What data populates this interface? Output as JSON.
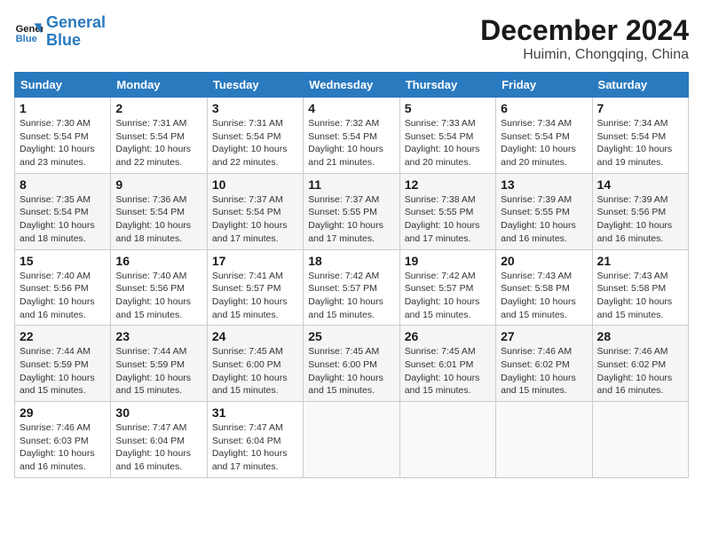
{
  "header": {
    "logo_line1": "General",
    "logo_line2": "Blue",
    "month": "December 2024",
    "location": "Huimin, Chongqing, China"
  },
  "days_of_week": [
    "Sunday",
    "Monday",
    "Tuesday",
    "Wednesday",
    "Thursday",
    "Friday",
    "Saturday"
  ],
  "weeks": [
    [
      {
        "day": "1",
        "info": "Sunrise: 7:30 AM\nSunset: 5:54 PM\nDaylight: 10 hours\nand 23 minutes."
      },
      {
        "day": "2",
        "info": "Sunrise: 7:31 AM\nSunset: 5:54 PM\nDaylight: 10 hours\nand 22 minutes."
      },
      {
        "day": "3",
        "info": "Sunrise: 7:31 AM\nSunset: 5:54 PM\nDaylight: 10 hours\nand 22 minutes."
      },
      {
        "day": "4",
        "info": "Sunrise: 7:32 AM\nSunset: 5:54 PM\nDaylight: 10 hours\nand 21 minutes."
      },
      {
        "day": "5",
        "info": "Sunrise: 7:33 AM\nSunset: 5:54 PM\nDaylight: 10 hours\nand 20 minutes."
      },
      {
        "day": "6",
        "info": "Sunrise: 7:34 AM\nSunset: 5:54 PM\nDaylight: 10 hours\nand 20 minutes."
      },
      {
        "day": "7",
        "info": "Sunrise: 7:34 AM\nSunset: 5:54 PM\nDaylight: 10 hours\nand 19 minutes."
      }
    ],
    [
      {
        "day": "8",
        "info": "Sunrise: 7:35 AM\nSunset: 5:54 PM\nDaylight: 10 hours\nand 18 minutes."
      },
      {
        "day": "9",
        "info": "Sunrise: 7:36 AM\nSunset: 5:54 PM\nDaylight: 10 hours\nand 18 minutes."
      },
      {
        "day": "10",
        "info": "Sunrise: 7:37 AM\nSunset: 5:54 PM\nDaylight: 10 hours\nand 17 minutes."
      },
      {
        "day": "11",
        "info": "Sunrise: 7:37 AM\nSunset: 5:55 PM\nDaylight: 10 hours\nand 17 minutes."
      },
      {
        "day": "12",
        "info": "Sunrise: 7:38 AM\nSunset: 5:55 PM\nDaylight: 10 hours\nand 17 minutes."
      },
      {
        "day": "13",
        "info": "Sunrise: 7:39 AM\nSunset: 5:55 PM\nDaylight: 10 hours\nand 16 minutes."
      },
      {
        "day": "14",
        "info": "Sunrise: 7:39 AM\nSunset: 5:56 PM\nDaylight: 10 hours\nand 16 minutes."
      }
    ],
    [
      {
        "day": "15",
        "info": "Sunrise: 7:40 AM\nSunset: 5:56 PM\nDaylight: 10 hours\nand 16 minutes."
      },
      {
        "day": "16",
        "info": "Sunrise: 7:40 AM\nSunset: 5:56 PM\nDaylight: 10 hours\nand 15 minutes."
      },
      {
        "day": "17",
        "info": "Sunrise: 7:41 AM\nSunset: 5:57 PM\nDaylight: 10 hours\nand 15 minutes."
      },
      {
        "day": "18",
        "info": "Sunrise: 7:42 AM\nSunset: 5:57 PM\nDaylight: 10 hours\nand 15 minutes."
      },
      {
        "day": "19",
        "info": "Sunrise: 7:42 AM\nSunset: 5:57 PM\nDaylight: 10 hours\nand 15 minutes."
      },
      {
        "day": "20",
        "info": "Sunrise: 7:43 AM\nSunset: 5:58 PM\nDaylight: 10 hours\nand 15 minutes."
      },
      {
        "day": "21",
        "info": "Sunrise: 7:43 AM\nSunset: 5:58 PM\nDaylight: 10 hours\nand 15 minutes."
      }
    ],
    [
      {
        "day": "22",
        "info": "Sunrise: 7:44 AM\nSunset: 5:59 PM\nDaylight: 10 hours\nand 15 minutes."
      },
      {
        "day": "23",
        "info": "Sunrise: 7:44 AM\nSunset: 5:59 PM\nDaylight: 10 hours\nand 15 minutes."
      },
      {
        "day": "24",
        "info": "Sunrise: 7:45 AM\nSunset: 6:00 PM\nDaylight: 10 hours\nand 15 minutes."
      },
      {
        "day": "25",
        "info": "Sunrise: 7:45 AM\nSunset: 6:00 PM\nDaylight: 10 hours\nand 15 minutes."
      },
      {
        "day": "26",
        "info": "Sunrise: 7:45 AM\nSunset: 6:01 PM\nDaylight: 10 hours\nand 15 minutes."
      },
      {
        "day": "27",
        "info": "Sunrise: 7:46 AM\nSunset: 6:02 PM\nDaylight: 10 hours\nand 15 minutes."
      },
      {
        "day": "28",
        "info": "Sunrise: 7:46 AM\nSunset: 6:02 PM\nDaylight: 10 hours\nand 16 minutes."
      }
    ],
    [
      {
        "day": "29",
        "info": "Sunrise: 7:46 AM\nSunset: 6:03 PM\nDaylight: 10 hours\nand 16 minutes."
      },
      {
        "day": "30",
        "info": "Sunrise: 7:47 AM\nSunset: 6:04 PM\nDaylight: 10 hours\nand 16 minutes."
      },
      {
        "day": "31",
        "info": "Sunrise: 7:47 AM\nSunset: 6:04 PM\nDaylight: 10 hours\nand 17 minutes."
      },
      {
        "day": "",
        "info": ""
      },
      {
        "day": "",
        "info": ""
      },
      {
        "day": "",
        "info": ""
      },
      {
        "day": "",
        "info": ""
      }
    ]
  ]
}
